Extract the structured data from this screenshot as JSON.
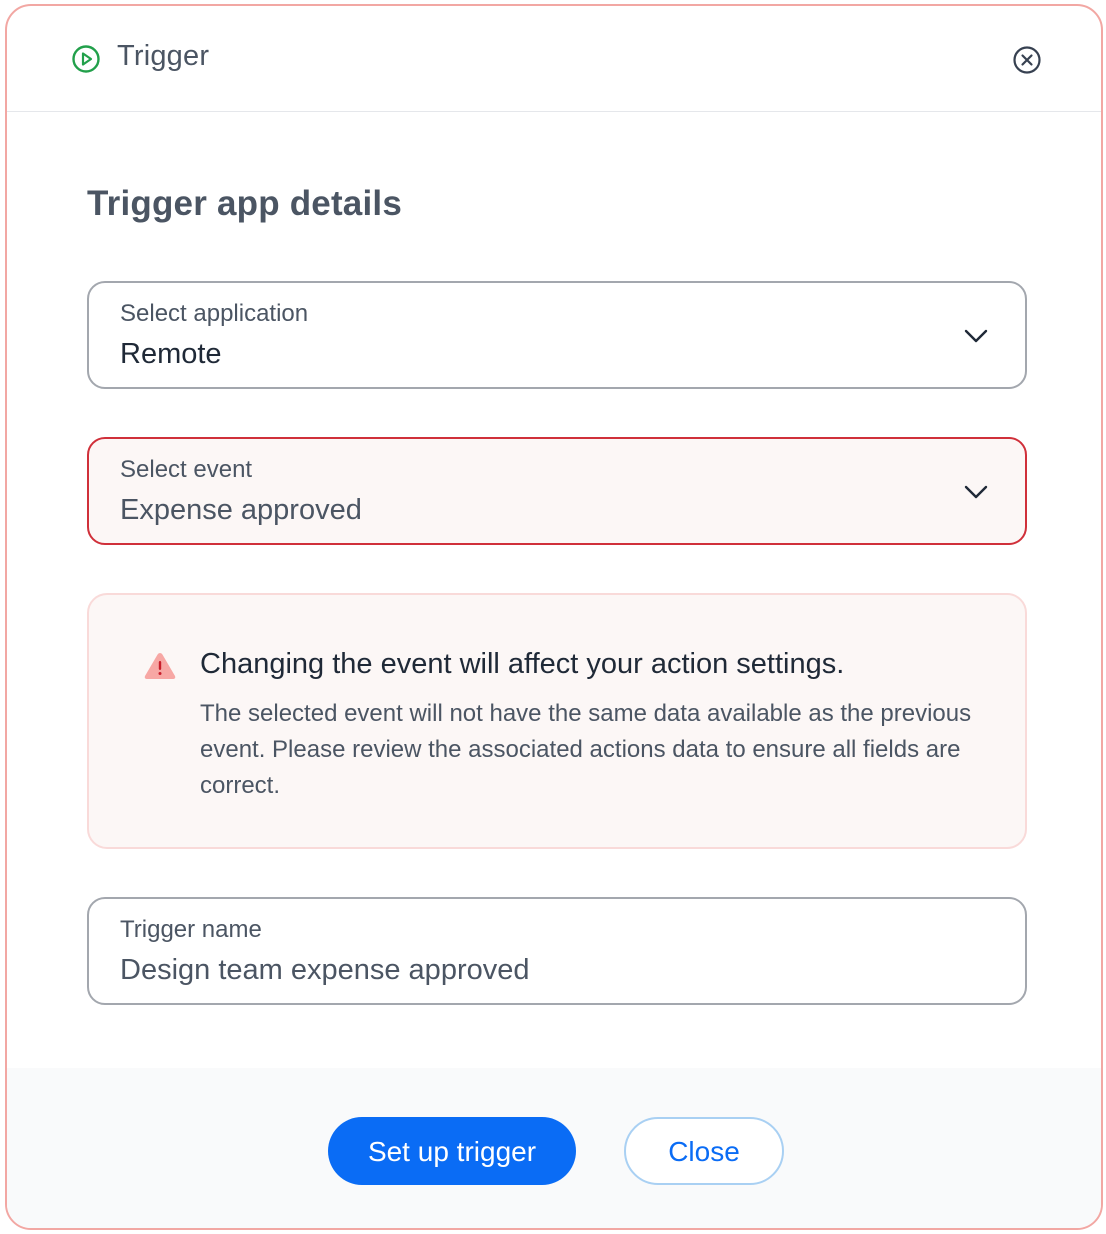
{
  "header": {
    "title": "Trigger",
    "icon": "play-circle-icon",
    "icon_color": "#22a04b",
    "close_icon": "close-circle-icon"
  },
  "section": {
    "title": "Trigger app details"
  },
  "fields": {
    "application": {
      "label": "Select application",
      "value": "Remote"
    },
    "event": {
      "label": "Select event",
      "value": "Expense approved",
      "state": "error",
      "border_color": "#d0303a"
    },
    "trigger_name": {
      "label": "Trigger name",
      "value": "Design team expense approved"
    }
  },
  "alert": {
    "icon": "warning-triangle-icon",
    "icon_color": "#f7a7a4",
    "title": "Changing the event will affect your action settings.",
    "body": "The selected event will not have the same data available as the previous event. Please review the associated actions data to ensure all fields are correct."
  },
  "footer": {
    "primary_label": "Set up trigger",
    "secondary_label": "Close",
    "accent_color": "#0a6cf5"
  }
}
